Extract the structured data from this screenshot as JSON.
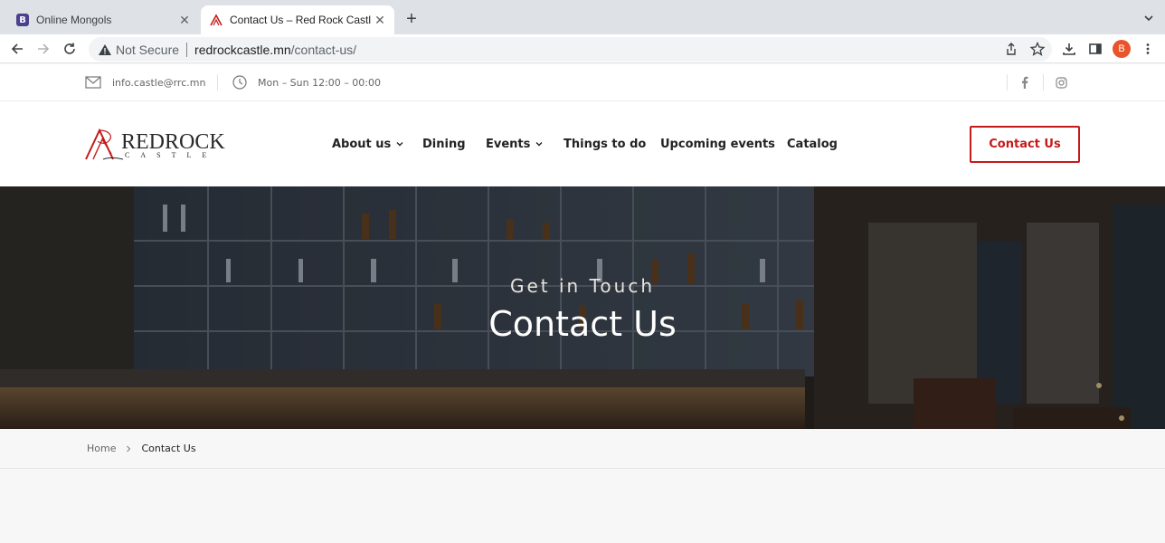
{
  "browser": {
    "tabs": [
      {
        "title": "Online Mongols",
        "favicon_letter": "B",
        "active": false
      },
      {
        "title": "Contact Us – Red Rock Castle",
        "active": true
      }
    ],
    "security_label": "Not Secure",
    "url_host": "redrockcastle.mn",
    "url_path": "/contact-us/",
    "profile_initial": "B"
  },
  "topbar": {
    "email": "info.castle@rrc.mn",
    "hours": "Mon – Sun 12:00 – 00:00"
  },
  "header": {
    "logo_word": "REDROCK",
    "logo_sub": "CASTLE",
    "nav": [
      {
        "label": "About us",
        "has_dropdown": true
      },
      {
        "label": "Dining",
        "has_dropdown": false
      },
      {
        "label": "Events",
        "has_dropdown": true
      },
      {
        "label": "Things to do",
        "has_dropdown": false
      },
      {
        "label": "Upcoming events",
        "has_dropdown": false
      },
      {
        "label": "Catalog",
        "has_dropdown": false
      }
    ],
    "cta_label": "Contact Us"
  },
  "hero": {
    "subtitle": "Get in Touch",
    "title": "Contact Us"
  },
  "breadcrumb": {
    "home": "Home",
    "current": "Contact Us"
  },
  "colors": {
    "brand_red": "#c41a1a",
    "avatar": "#e8542c"
  }
}
